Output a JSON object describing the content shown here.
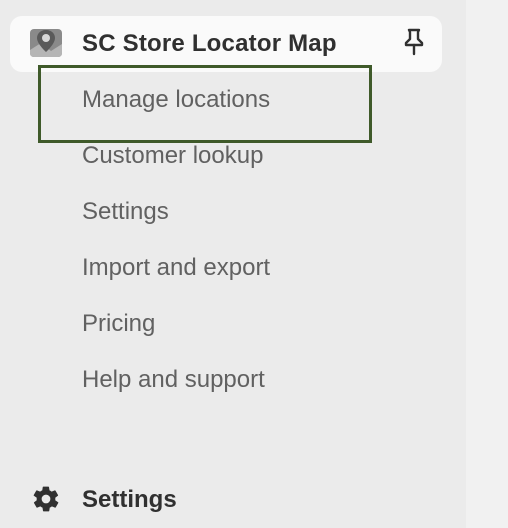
{
  "app": {
    "title": "SC Store Locator Map",
    "icon": "map-pin-icon"
  },
  "sub_nav": {
    "items": [
      {
        "label": "Manage locations",
        "highlighted": true
      },
      {
        "label": "Customer lookup"
      },
      {
        "label": "Settings"
      },
      {
        "label": "Import and export"
      },
      {
        "label": "Pricing"
      },
      {
        "label": "Help and support"
      }
    ]
  },
  "bottom_nav": {
    "settings_label": "Settings",
    "icon": "gear-icon"
  },
  "colors": {
    "highlight_border": "#3f5a2a",
    "sidebar_bg": "#ebebeb",
    "header_bg": "#fafafa"
  }
}
